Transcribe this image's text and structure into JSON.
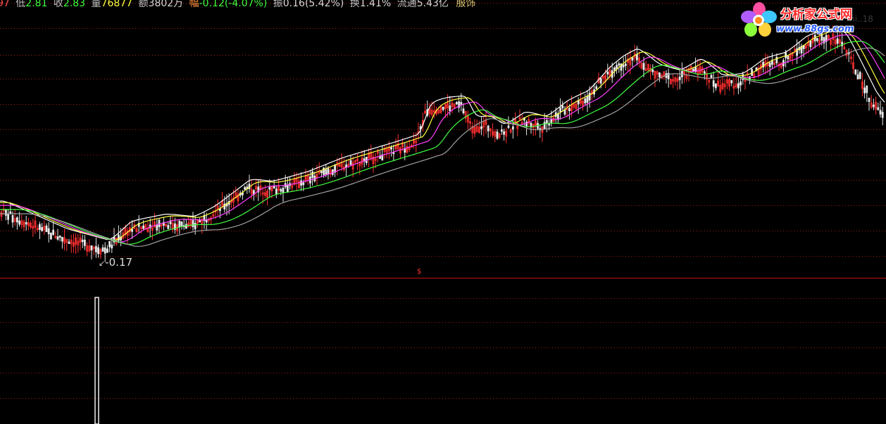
{
  "info": {
    "prev_tail": "97",
    "low_label": "低",
    "low_value": "2.81",
    "close_label": "收",
    "close_value": "2.83",
    "volume_label": "量",
    "volume_value": "76877",
    "amount_label": "额",
    "amount_value": "3802",
    "amount_unit": "万",
    "change_label": "幅",
    "change_value": "-0.12(-4.07%)",
    "amplitude_label": "振",
    "amplitude_value": "0.16(5.42%)",
    "turnover_label": "换",
    "turnover_value": "1.41%",
    "float_label": "流通",
    "float_value": "5.43亿",
    "sector": "服饰"
  },
  "logo": {
    "title": "分析家公式网",
    "url": "www.88gs.com",
    "watermark": "mi..18"
  },
  "markers": {
    "low_marker_prefix": "↙",
    "low_marker": "-0.17",
    "dollar": "$"
  },
  "colors": {
    "background": "#000000",
    "grid": "#a01818",
    "divider": "#c01010",
    "up_candle": "#ff3030",
    "down_candle": "#e8e8e8",
    "ma_white": "#ffffff",
    "ma_yellow": "#ffff40",
    "ma_magenta": "#ff40ff",
    "ma_green": "#40ff40",
    "ma_grey": "#a0a0a0",
    "indicator": "#ffffff"
  },
  "chart_data": {
    "type": "candlestick",
    "title": "",
    "xlabel": "",
    "ylabel": "",
    "low_annotation": -0.17,
    "indicator_spike_index": 37
  }
}
